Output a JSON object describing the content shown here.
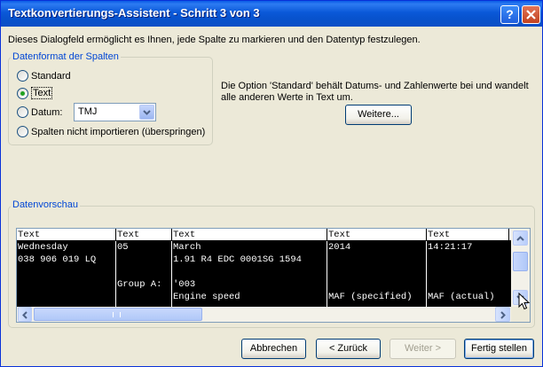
{
  "window": {
    "title": "Textkonvertierungs-Assistent - Schritt 3 von 3",
    "help_label": "?"
  },
  "description": "Dieses Dialogfeld ermöglicht es Ihnen, jede Spalte zu markieren und den Datentyp festzulegen.",
  "column_format": {
    "legend": "Datenformat der Spalten",
    "options": [
      {
        "label": "Standard",
        "checked": false
      },
      {
        "label": "Text",
        "checked": true
      },
      {
        "label": "Datum:",
        "checked": false
      },
      {
        "label": "Spalten nicht importieren (überspringen)",
        "checked": false
      }
    ],
    "date_format": "TMJ"
  },
  "info_text": "Die Option 'Standard' behält Datums- und Zahlenwerte bei und wandelt alle anderen Werte in Text um.",
  "more_button": "Weitere...",
  "preview": {
    "legend": "Datenvorschau",
    "headers": [
      "Text",
      "Text",
      "Text",
      "Text",
      "Text"
    ],
    "rows": [
      [
        "Wednesday",
        "05",
        "March",
        "2014",
        "14:21:17"
      ],
      [
        "038 906 019 LQ",
        "",
        "1.91 R4 EDC 0001SG  1594",
        "",
        ""
      ],
      [
        "",
        "",
        "",
        "",
        ""
      ],
      [
        "",
        "Group A:",
        "'003",
        "",
        ""
      ],
      [
        "",
        "",
        "Engine speed",
        "MAF (specified)",
        "MAF (actual)"
      ]
    ]
  },
  "buttons": {
    "cancel": "Abbrechen",
    "back": "< Zurück",
    "next": "Weiter >",
    "finish": "Fertig stellen"
  },
  "colors": {
    "title_bar": "#0A58D8",
    "dialog_bg": "#ECE9D8",
    "legend_text": "#0046D5",
    "radio_dot": "#21A121",
    "preview_selected_bg": "#000000"
  }
}
